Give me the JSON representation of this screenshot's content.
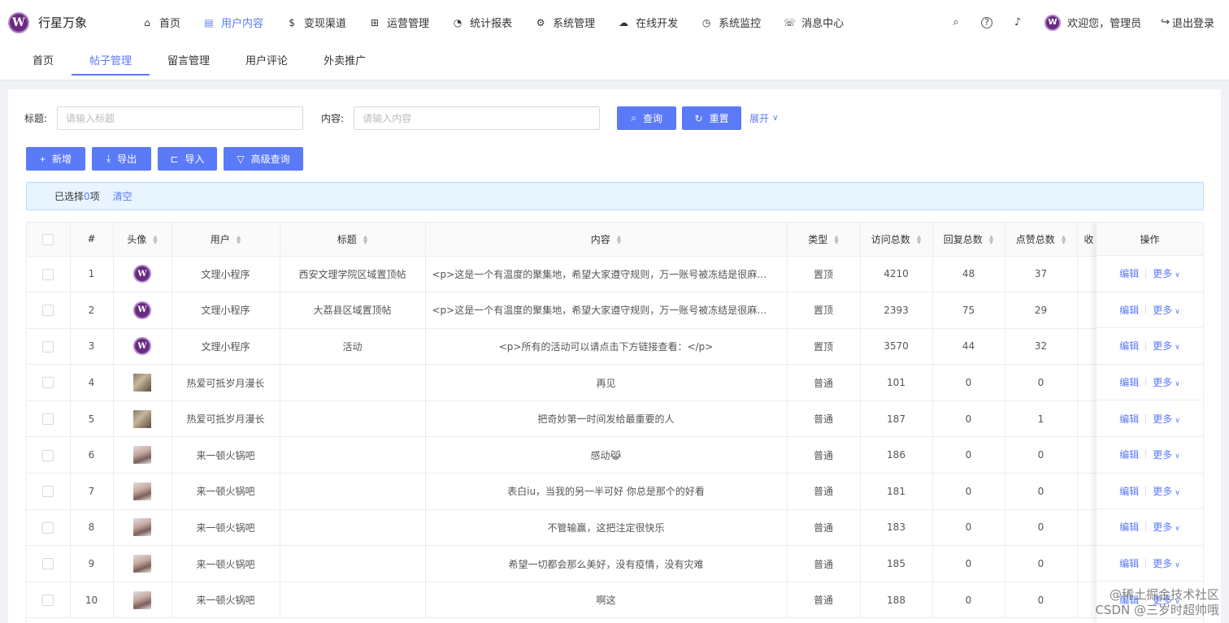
{
  "app": {
    "name": "行星万象",
    "logo_letter": "W"
  },
  "topnav": [
    {
      "label": "首页",
      "icon": "home-icon",
      "glyph": "⌂",
      "active": false
    },
    {
      "label": "用户内容",
      "icon": "document-icon",
      "glyph": "▤",
      "active": true
    },
    {
      "label": "变现渠道",
      "icon": "dollar-icon",
      "glyph": "$",
      "active": false
    },
    {
      "label": "运营管理",
      "icon": "puzzle-icon",
      "glyph": "⊞",
      "active": false
    },
    {
      "label": "统计报表",
      "icon": "pie-chart-icon",
      "glyph": "◔",
      "active": false
    },
    {
      "label": "系统管理",
      "icon": "gear-icon",
      "glyph": "⚙",
      "active": false
    },
    {
      "label": "在线开发",
      "icon": "cloud-icon",
      "glyph": "☁",
      "active": false
    },
    {
      "label": "系统监控",
      "icon": "dashboard-icon",
      "glyph": "◷",
      "active": false
    },
    {
      "label": "消息中心",
      "icon": "message-icon",
      "glyph": "☏",
      "active": false
    }
  ],
  "header": {
    "welcome": "欢迎您，管理员",
    "logout": "退出登录",
    "search_glyph": "⌕",
    "help_glyph": "?",
    "bell_glyph": "♪",
    "logout_glyph": "↪"
  },
  "subtabs": [
    {
      "label": "首页",
      "active": false
    },
    {
      "label": "帖子管理",
      "active": true
    },
    {
      "label": "留言管理",
      "active": false
    },
    {
      "label": "用户评论",
      "active": false
    },
    {
      "label": "外卖推广",
      "active": false
    }
  ],
  "search": {
    "title_label": "标题:",
    "title_placeholder": "请输入标题",
    "content_label": "内容:",
    "content_placeholder": "请输入内容",
    "query": "查询",
    "reset": "重置",
    "expand": "展开"
  },
  "actions": {
    "add": "新增",
    "export": "导出",
    "import": "导入",
    "advanced": "高级查询"
  },
  "selection": {
    "prefix": "已选择 ",
    "count": "0",
    "suffix": "项",
    "clear": "清空"
  },
  "table": {
    "headers": {
      "index": "#",
      "avatar": "头像",
      "user": "用户",
      "title": "标题",
      "content": "内容",
      "type": "类型",
      "visits": "访问总数",
      "replies": "回复总数",
      "likes": "点赞总数",
      "collect": "收",
      "ops": "操作"
    },
    "edit_label": "编辑",
    "more_label": "更多",
    "rows": [
      {
        "index": "1",
        "avatar": "logo",
        "user": "文理小程序",
        "title": "西安文理学院区域置顶帖",
        "content": "<p>这是一个有温度的聚集地，希望大家遵守规则，万一账号被冻结是很麻…",
        "align": "left",
        "type": "置顶",
        "visits": "4210",
        "replies": "48",
        "likes": "37"
      },
      {
        "index": "2",
        "avatar": "logo",
        "user": "文理小程序",
        "title": "大荔县区域置顶帖",
        "content": "<p>这是一个有温度的聚集地，希望大家遵守规则，万一账号被冻结是很麻…",
        "align": "left",
        "type": "置顶",
        "visits": "2393",
        "replies": "75",
        "likes": "29"
      },
      {
        "index": "3",
        "avatar": "logo",
        "user": "文理小程序",
        "title": "活动",
        "content": "<p>所有的活动可以请点击下方链接查看：</p>",
        "align": "center",
        "type": "置顶",
        "visits": "3570",
        "replies": "44",
        "likes": "32"
      },
      {
        "index": "4",
        "avatar": "photo1",
        "user": "热爱可抵岁月漫长",
        "title": "",
        "content": "再见",
        "align": "center",
        "type": "普通",
        "visits": "101",
        "replies": "0",
        "likes": "0"
      },
      {
        "index": "5",
        "avatar": "photo1",
        "user": "热爱可抵岁月漫长",
        "title": "",
        "content": "把奇妙第一时间发给最重要的人",
        "align": "center",
        "type": "普通",
        "visits": "187",
        "replies": "0",
        "likes": "1"
      },
      {
        "index": "6",
        "avatar": "photo2",
        "user": "来一顿火锅吧",
        "title": "",
        "content": "感动😹",
        "align": "center",
        "type": "普通",
        "visits": "186",
        "replies": "0",
        "likes": "0"
      },
      {
        "index": "7",
        "avatar": "photo2",
        "user": "来一顿火锅吧",
        "title": "",
        "content": "表白iu，当我的另一半可好 你总是那个的好看",
        "align": "center",
        "type": "普通",
        "visits": "181",
        "replies": "0",
        "likes": "0"
      },
      {
        "index": "8",
        "avatar": "photo2",
        "user": "来一顿火锅吧",
        "title": "",
        "content": "不管输赢，这把注定很快乐",
        "align": "center",
        "type": "普通",
        "visits": "183",
        "replies": "0",
        "likes": "0"
      },
      {
        "index": "9",
        "avatar": "photo2",
        "user": "来一顿火锅吧",
        "title": "",
        "content": "希望一切都会那么美好，没有疫情，没有灾难",
        "align": "center",
        "type": "普通",
        "visits": "185",
        "replies": "0",
        "likes": "0"
      },
      {
        "index": "10",
        "avatar": "photo2",
        "user": "来一顿火锅吧",
        "title": "",
        "content": "啊这",
        "align": "center",
        "type": "普通",
        "visits": "188",
        "replies": "0",
        "likes": "0"
      }
    ]
  },
  "watermark": {
    "line1": "@稀土掘金技术社区",
    "line2": "CSDN @三岁时超帅哦"
  },
  "colors": {
    "primary": "#5a7af8",
    "brand": "#6a2a82"
  }
}
